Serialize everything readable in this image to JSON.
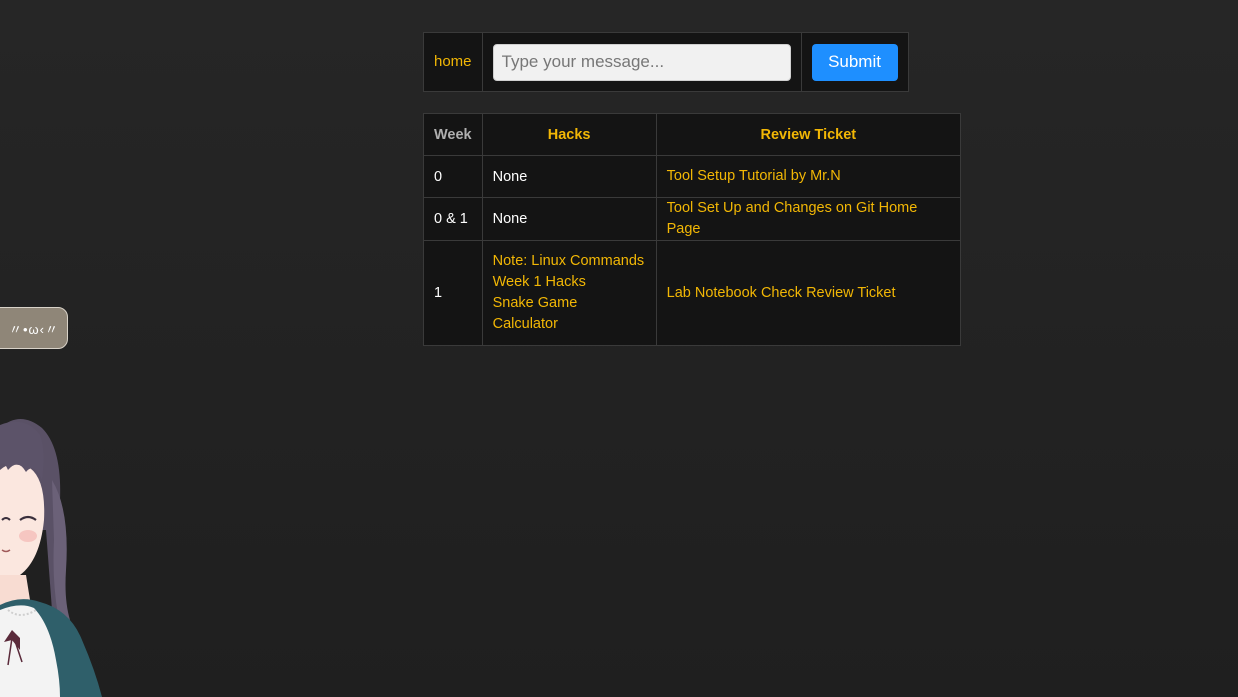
{
  "nav": {
    "home_label": "home",
    "message_placeholder": "Type your message...",
    "submit_label": "Submit"
  },
  "table": {
    "headers": {
      "week": "Week",
      "hacks": "Hacks",
      "review": "Review Ticket"
    },
    "rows": [
      {
        "week": "0",
        "hacks_text": "None",
        "review": "Tool Setup Tutorial by Mr.N"
      },
      {
        "week": "0 & 1",
        "hacks_text": "None",
        "review": "Tool Set Up and Changes on Git Home Page"
      },
      {
        "week": "1",
        "hacks_links": [
          "Note: Linux Commands",
          "Week 1 Hacks",
          "Snake Game",
          "Calculator"
        ],
        "review": "Lab Notebook Check Review Ticket"
      }
    ]
  },
  "bubble": {
    "text": "〃•ω‹〃"
  },
  "colors": {
    "background": "#232323",
    "table_bg": "#141414",
    "accent_gold": "#f2b705",
    "submit_blue": "#1e8fff"
  },
  "icons": {
    "mascot": "anime-girl-mascot"
  }
}
